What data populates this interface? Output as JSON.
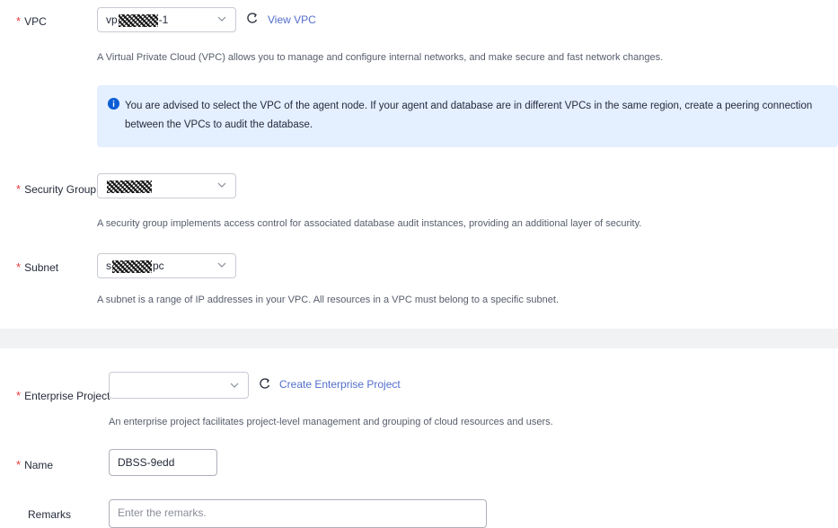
{
  "vpc": {
    "label": "VPC",
    "required_mark": "*",
    "value_prefix": "vp",
    "value_suffix": "-1",
    "view_link": "View VPC",
    "help": "A Virtual Private Cloud (VPC) allows you to manage and configure internal networks, and make secure and fast network changes.",
    "notice": "You are advised to select the VPC of the agent node. If your agent and database are in different VPCs in the same region, create a peering connection between the VPCs to audit the database."
  },
  "security_group": {
    "label": "Security Group",
    "required_mark": "*",
    "value_prefix": "",
    "value_suffix": "",
    "help": "A security group implements access control for associated database audit instances, providing an additional layer of security."
  },
  "subnet": {
    "label": "Subnet",
    "required_mark": "*",
    "value_prefix": "s",
    "value_suffix": "pc",
    "help": "A subnet is a range of IP addresses in your VPC. All resources in a VPC must belong to a specific subnet."
  },
  "enterprise_project": {
    "label": "Enterprise Project",
    "required_mark": "*",
    "value": "",
    "create_link": "Create Enterprise Project",
    "help": "An enterprise project facilitates project-level management and grouping of cloud resources and users."
  },
  "name": {
    "label": "Name",
    "required_mark": "*",
    "value": "DBSS-9edd"
  },
  "remarks": {
    "label": "Remarks",
    "placeholder": "Enter the remarks."
  },
  "colors": {
    "required": "#e4393c",
    "link": "#526ecc",
    "notice_bg": "#e4efff",
    "info_icon": "#0a5dd4",
    "band": "#f1f2f4"
  },
  "icons": {
    "refresh": "refresh-icon",
    "chevron": "chevron-down-icon",
    "info": "info-icon"
  }
}
